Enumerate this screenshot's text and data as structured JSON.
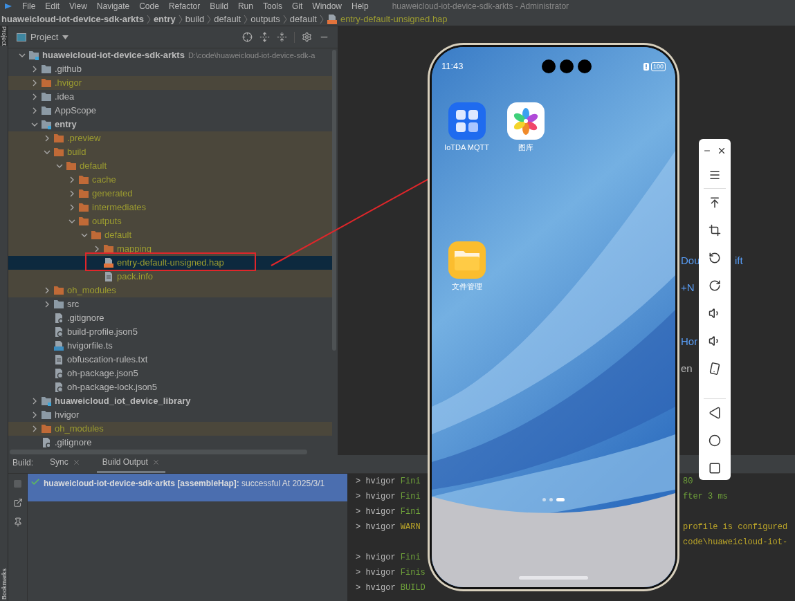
{
  "menu": {
    "items": [
      "File",
      "Edit",
      "View",
      "Navigate",
      "Code",
      "Refactor",
      "Build",
      "Run",
      "Tools",
      "Git",
      "Window",
      "Help"
    ],
    "title": "huaweicloud-iot-device-sdk-arkts - Administrator"
  },
  "breadcrumb": [
    {
      "label": "huaweicloud-iot-device-sdk-arkts",
      "kind": "project"
    },
    {
      "label": "entry",
      "kind": "module"
    },
    {
      "label": "build",
      "kind": "folder"
    },
    {
      "label": "default",
      "kind": "folder"
    },
    {
      "label": "outputs",
      "kind": "folder"
    },
    {
      "label": "default",
      "kind": "folder"
    },
    {
      "label": "entry-default-unsigned.hap",
      "kind": "hap"
    }
  ],
  "side_tabs": {
    "top": "Project",
    "bottom": "Bookmarks"
  },
  "project_panel": {
    "title": "Project",
    "tree": [
      {
        "label": "huaweicloud-iot-device-sdk-arkts",
        "path": "D:\\code\\huaweicloud-iot-device-sdk-a",
        "kind": "module",
        "expanded": true,
        "excluded": false,
        "selected": false,
        "children": [
          {
            "label": ".github",
            "kind": "folder",
            "expanded": false,
            "excluded": false,
            "selected": false
          },
          {
            "label": ".hvigor",
            "kind": "folder",
            "expanded": false,
            "excluded": true,
            "selected": false
          },
          {
            "label": ".idea",
            "kind": "folder",
            "expanded": false,
            "excluded": false,
            "selected": false
          },
          {
            "label": "AppScope",
            "kind": "folder",
            "expanded": false,
            "excluded": false,
            "selected": false
          },
          {
            "label": "entry",
            "kind": "module",
            "expanded": true,
            "excluded": false,
            "selected": false,
            "children": [
              {
                "label": ".preview",
                "kind": "folder",
                "expanded": false,
                "excluded": true,
                "selected": false
              },
              {
                "label": "build",
                "kind": "folder",
                "expanded": true,
                "excluded": true,
                "selected": false,
                "children": [
                  {
                    "label": "default",
                    "kind": "folder",
                    "expanded": true,
                    "excluded": true,
                    "selected": false,
                    "children": [
                      {
                        "label": "cache",
                        "kind": "folder",
                        "expanded": false,
                        "excluded": true,
                        "selected": false
                      },
                      {
                        "label": "generated",
                        "kind": "folder",
                        "expanded": false,
                        "excluded": true,
                        "selected": false
                      },
                      {
                        "label": "intermediates",
                        "kind": "folder",
                        "expanded": false,
                        "excluded": true,
                        "selected": false
                      },
                      {
                        "label": "outputs",
                        "kind": "folder",
                        "expanded": true,
                        "excluded": true,
                        "selected": false,
                        "children": [
                          {
                            "label": "default",
                            "kind": "folder",
                            "expanded": true,
                            "excluded": true,
                            "selected": false,
                            "children": [
                              {
                                "label": "mapping",
                                "kind": "folder",
                                "expanded": false,
                                "excluded": true,
                                "selected": false
                              },
                              {
                                "label": "entry-default-unsigned.hap",
                                "kind": "hap",
                                "excluded": true,
                                "selected": true
                              },
                              {
                                "label": "pack.info",
                                "kind": "text",
                                "excluded": true,
                                "selected": false
                              }
                            ]
                          }
                        ]
                      }
                    ]
                  }
                ]
              },
              {
                "label": "oh_modules",
                "kind": "folder",
                "expanded": false,
                "excluded": true,
                "selected": false
              },
              {
                "label": "src",
                "kind": "folder",
                "expanded": false,
                "excluded": false,
                "selected": false
              },
              {
                "label": ".gitignore",
                "kind": "ignore",
                "excluded": false,
                "selected": false
              },
              {
                "label": "build-profile.json5",
                "kind": "config",
                "excluded": false,
                "selected": false
              },
              {
                "label": "hvigorfile.ts",
                "kind": "ts",
                "excluded": false,
                "selected": false
              },
              {
                "label": "obfuscation-rules.txt",
                "kind": "text",
                "excluded": false,
                "selected": false
              },
              {
                "label": "oh-package.json5",
                "kind": "config",
                "excluded": false,
                "selected": false
              },
              {
                "label": "oh-package-lock.json5",
                "kind": "config",
                "excluded": false,
                "selected": false
              }
            ]
          },
          {
            "label": "huaweicloud_iot_device_library",
            "kind": "module",
            "expanded": false,
            "excluded": false,
            "selected": false
          },
          {
            "label": "hvigor",
            "kind": "folder",
            "expanded": false,
            "excluded": false,
            "selected": false
          },
          {
            "label": "oh_modules",
            "kind": "folder",
            "expanded": false,
            "excluded": true,
            "selected": false
          },
          {
            "label": ".gitignore",
            "kind": "ignore",
            "excluded": false,
            "selected": false
          }
        ]
      }
    ]
  },
  "editor_fragments": [
    {
      "left": "Dou",
      "right": "ift",
      "kind": "link"
    },
    {
      "left": "+N",
      "kind": "link"
    },
    {
      "left": "Hor",
      "kind": "link"
    },
    {
      "left": "en",
      "kind": "plain"
    }
  ],
  "build_panel": {
    "label": "Build:",
    "tabs": [
      {
        "label": "Sync",
        "selected": false
      },
      {
        "label": "Build Output",
        "selected": true
      }
    ],
    "results": [
      {
        "text": "**huaweicloud-iot-device-sdk-arkts [assembleHap]:** successful At 2025/3/1",
        "succeeded": true,
        "selected": true
      }
    ],
    "console": [
      {
        "prefix": "> hvigor",
        "word": "Fini",
        "kind": "info",
        "tail": {
          "text": "80",
          "kind": "info"
        }
      },
      {
        "prefix": "> hvigor",
        "word": "Fini",
        "kind": "info",
        "tail": {
          "text": "fter 3 ms",
          "kind": "info"
        }
      },
      {
        "prefix": "> hvigor",
        "word": "Fini",
        "kind": "info"
      },
      {
        "prefix": "> hvigor",
        "word": "WARN",
        "kind": "warn",
        "tail": {
          "text": "profile is configured",
          "kind": "warn"
        }
      },
      {
        "tail": {
          "text": "code\\huaweicloud-iot-",
          "kind": "warn"
        }
      },
      {
        "prefix": "> hvigor",
        "word": "Fini",
        "kind": "info"
      },
      {
        "prefix": "> hvigor",
        "word": "Finis",
        "kind": "info"
      },
      {
        "prefix": "> hvigor",
        "word": "BUILD",
        "kind": "info"
      }
    ]
  },
  "phone": {
    "time": "11:43",
    "battery": "100",
    "apps": [
      {
        "label": "IoTDA MQTT",
        "kind": "grid"
      },
      {
        "label": "图库",
        "kind": "gallery"
      },
      {
        "label": "文件管理",
        "kind": "files"
      }
    ],
    "page_dots": [
      {
        "selected": false
      },
      {
        "selected": false
      },
      {
        "selected": true
      }
    ]
  }
}
